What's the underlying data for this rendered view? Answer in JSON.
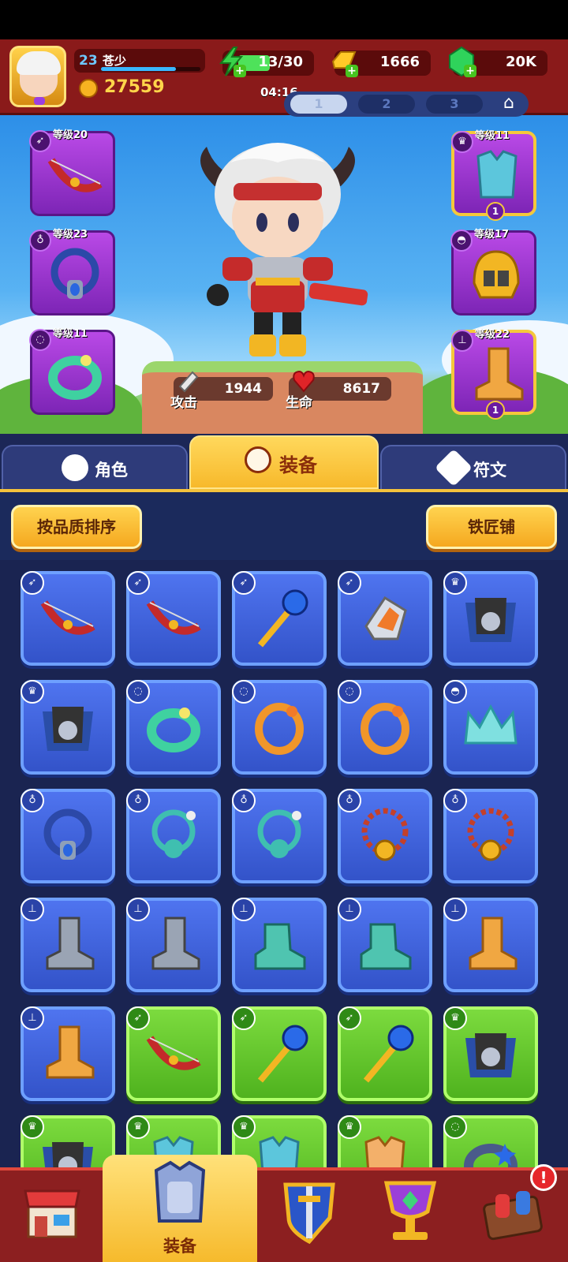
{
  "player": {
    "level": "23",
    "name": "苍少",
    "xp_fraction": 0.75,
    "power": "27559"
  },
  "resources": {
    "energy": {
      "icon": "energy-icon",
      "value": "13/30",
      "fill_fraction": 0.43
    },
    "gold": {
      "icon": "gold-bar-icon",
      "value": "1666"
    },
    "gems": {
      "icon": "emerald-icon",
      "value": "20K"
    }
  },
  "timer": "04:16",
  "presets": [
    "1",
    "2",
    "3"
  ],
  "active_preset": "1",
  "equipped": {
    "left": [
      {
        "level_label": "等级20",
        "slot_icon": "weapon-slot-icon",
        "item_icon": "bow-icon"
      },
      {
        "level_label": "等级23",
        "slot_icon": "necklace-slot-icon",
        "item_icon": "amulet-icon"
      },
      {
        "level_label": "等级11",
        "slot_icon": "ring-slot-icon",
        "item_icon": "ring-icon"
      }
    ],
    "right": [
      {
        "level_label": "等级11",
        "slot_icon": "armor-slot-icon",
        "item_icon": "armor-icon",
        "badge": "1"
      },
      {
        "level_label": "等级17",
        "slot_icon": "helmet-slot-icon",
        "item_icon": "helmet-icon"
      },
      {
        "level_label": "等级22",
        "slot_icon": "boots-slot-icon",
        "item_icon": "boots-icon",
        "badge": "1"
      }
    ]
  },
  "stats": {
    "attack": {
      "label": "攻击",
      "value": "1944"
    },
    "health": {
      "label": "生命",
      "value": "8617"
    }
  },
  "tabs": [
    {
      "label": "角色",
      "icon": "character-icon"
    },
    {
      "label": "装备",
      "icon": "equipment-icon",
      "active": true
    },
    {
      "label": "符文",
      "icon": "rune-icon"
    }
  ],
  "toolbar": {
    "sort_label": "按品质排序",
    "smith_label": "铁匠铺"
  },
  "inventory": [
    {
      "slot": "weapon",
      "item": "bow",
      "rarity": "blue"
    },
    {
      "slot": "weapon",
      "item": "bow",
      "rarity": "blue"
    },
    {
      "slot": "weapon",
      "item": "staff",
      "rarity": "blue"
    },
    {
      "slot": "weapon",
      "item": "gauntlet",
      "rarity": "blue"
    },
    {
      "slot": "armor",
      "item": "cloak-armor",
      "rarity": "blue"
    },
    {
      "slot": "armor",
      "item": "cloak-armor",
      "rarity": "blue"
    },
    {
      "slot": "ring",
      "item": "green-ring",
      "rarity": "blue"
    },
    {
      "slot": "ring",
      "item": "orange-ring",
      "rarity": "blue"
    },
    {
      "slot": "ring",
      "item": "orange-ring",
      "rarity": "blue"
    },
    {
      "slot": "helmet",
      "item": "crown",
      "rarity": "blue"
    },
    {
      "slot": "necklace",
      "item": "blue-amulet",
      "rarity": "blue"
    },
    {
      "slot": "necklace",
      "item": "octopus-amulet",
      "rarity": "blue"
    },
    {
      "slot": "necklace",
      "item": "octopus-amulet",
      "rarity": "blue"
    },
    {
      "slot": "necklace",
      "item": "chain-amulet",
      "rarity": "blue"
    },
    {
      "slot": "necklace",
      "item": "chain-amulet",
      "rarity": "blue"
    },
    {
      "slot": "boots",
      "item": "grey-boots",
      "rarity": "blue"
    },
    {
      "slot": "boots",
      "item": "grey-boots",
      "rarity": "blue"
    },
    {
      "slot": "boots",
      "item": "teal-boots",
      "rarity": "blue"
    },
    {
      "slot": "boots",
      "item": "teal-boots",
      "rarity": "blue"
    },
    {
      "slot": "boots",
      "item": "orange-boots",
      "rarity": "blue"
    },
    {
      "slot": "boots",
      "item": "orange-boots",
      "rarity": "blue"
    },
    {
      "slot": "weapon",
      "item": "bow",
      "rarity": "green"
    },
    {
      "slot": "weapon",
      "item": "staff",
      "rarity": "green"
    },
    {
      "slot": "weapon",
      "item": "staff",
      "rarity": "green"
    },
    {
      "slot": "armor",
      "item": "cloak-armor",
      "rarity": "green"
    },
    {
      "slot": "armor",
      "item": "cloak-armor",
      "rarity": "green"
    },
    {
      "slot": "armor",
      "item": "teal-armor",
      "rarity": "green"
    },
    {
      "slot": "armor",
      "item": "teal-armor",
      "rarity": "green"
    },
    {
      "slot": "armor",
      "item": "orange-armor",
      "rarity": "green"
    },
    {
      "slot": "ring",
      "item": "blue-ring",
      "rarity": "green"
    }
  ],
  "bottom_nav": [
    {
      "icon": "shop-icon"
    },
    {
      "icon": "equipment-nav-icon",
      "label": "装备",
      "active": true
    },
    {
      "icon": "shield-sword-icon"
    },
    {
      "icon": "trophy-icon"
    },
    {
      "icon": "events-icon",
      "notification": "!"
    }
  ],
  "colors": {
    "header": "#8a1a1a",
    "accent": "#f7b92b",
    "rarity_blue": "#3f63de",
    "rarity_green": "#5fbf27",
    "slot_purple": "#9b37d3"
  }
}
